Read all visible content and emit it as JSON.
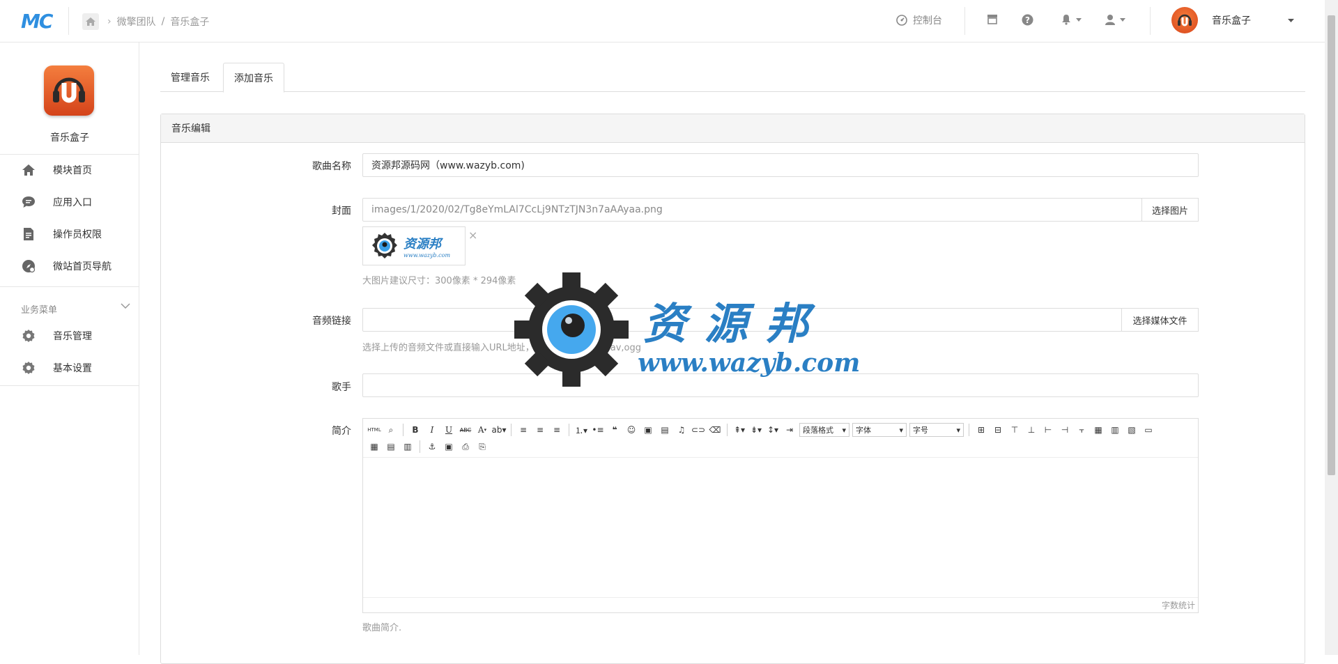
{
  "header": {
    "logo": "MC",
    "breadcrumb": {
      "team": "微擎团队",
      "separator": "/",
      "app": "音乐盒子"
    },
    "console_label": "控制台",
    "user_name": "音乐盒子"
  },
  "sidebar": {
    "app_name": "音乐盒子",
    "items": [
      {
        "label": "模块首页",
        "icon": "home-icon"
      },
      {
        "label": "应用入口",
        "icon": "chat-icon"
      },
      {
        "label": "操作员权限",
        "icon": "document-icon"
      },
      {
        "label": "微站首页导航",
        "icon": "compass-icon"
      }
    ],
    "group_label": "业务菜单",
    "group_items": [
      {
        "label": "音乐管理",
        "icon": "gear-icon"
      },
      {
        "label": "基本设置",
        "icon": "gear-icon"
      }
    ]
  },
  "tabs": [
    {
      "label": "管理音乐",
      "active": false
    },
    {
      "label": "添加音乐",
      "active": true
    }
  ],
  "panel": {
    "title": "音乐编辑",
    "song_name": {
      "label": "歌曲名称",
      "value": "资源邦源码网（www.wazyb.com)"
    },
    "cover": {
      "label": "封面",
      "value": "images/1/2020/02/Tg8eYmLAl7CcLj9NTzTJN3n7aAAyaa.png",
      "button": "选择图片",
      "thumb_text": "资源邦",
      "thumb_url": "www.wazyb.com",
      "help": "大图片建议尺寸：300像素 * 294像素"
    },
    "audio": {
      "label": "音频链接",
      "value": "",
      "button": "选择媒体文件",
      "help": "选择上传的音频文件或直接输入URL地址，常用格式：mp3,wav,ogg"
    },
    "singer": {
      "label": "歌手",
      "value": ""
    },
    "intro": {
      "label": "简介",
      "toolbar": {
        "html": "HTML",
        "bold": "B",
        "italic": "I",
        "underline": "U",
        "strike": "ABC",
        "font_color": "A",
        "paragraph": "段落格式",
        "font": "字体",
        "size": "字号"
      },
      "word_count": "字数统计",
      "help": "歌曲简介."
    }
  },
  "watermark": {
    "text": "资 源 邦",
    "url": "www.wazyb.com"
  },
  "colors": {
    "brand": "#2f8fe0",
    "accent": "#e4572e",
    "border": "#dddddd"
  }
}
